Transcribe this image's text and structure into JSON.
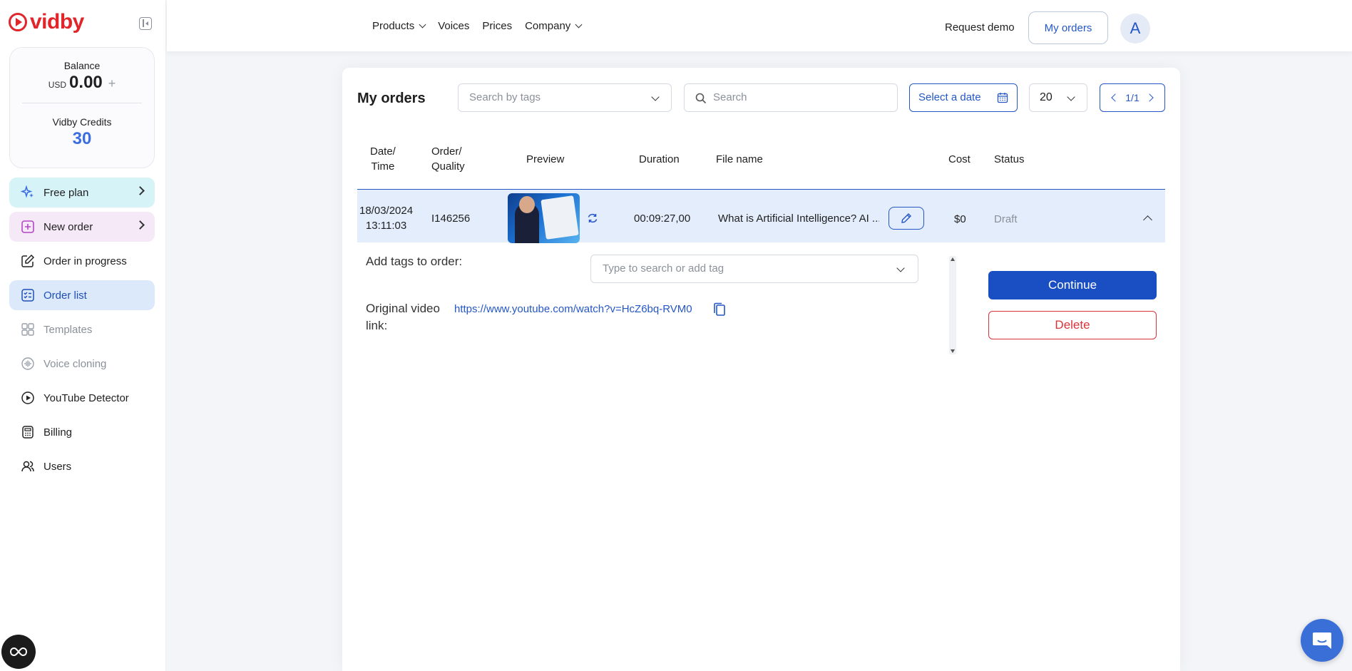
{
  "brand": {
    "name_prefix": "vid",
    "name_suffix": "by"
  },
  "balance": {
    "label": "Balance",
    "currency": "USD",
    "amount": "0.00",
    "plus": "+"
  },
  "credits": {
    "label": "Vidby Credits",
    "value": "30"
  },
  "sidebar": {
    "items": [
      {
        "label": "Free plan",
        "icon": "sparkle-icon"
      },
      {
        "label": "New order",
        "icon": "plus-square-icon"
      },
      {
        "label": "Order in progress",
        "icon": "edit-icon"
      },
      {
        "label": "Order list",
        "icon": "list-icon"
      },
      {
        "label": "Templates",
        "icon": "grid-icon"
      },
      {
        "label": "Voice cloning",
        "icon": "waveform-icon"
      },
      {
        "label": "YouTube Detector",
        "icon": "play-circle-icon"
      },
      {
        "label": "Billing",
        "icon": "calculator-icon"
      },
      {
        "label": "Users",
        "icon": "users-icon"
      }
    ]
  },
  "header": {
    "nav": [
      "Products",
      "Voices",
      "Prices",
      "Company"
    ],
    "request_demo": "Request demo",
    "my_orders": "My orders",
    "avatar": "A"
  },
  "orders": {
    "title": "My orders",
    "tags_placeholder": "Search by tags",
    "search_placeholder": "Search",
    "date_placeholder": "Select a date",
    "per_page": "20",
    "pager": "1/1",
    "columns": {
      "date_1": "Date/",
      "date_2": "Time",
      "order_1": "Order/",
      "order_2": "Quality",
      "preview": "Preview",
      "duration": "Duration",
      "file_name": "File name",
      "cost": "Cost",
      "status": "Status"
    },
    "rows": [
      {
        "date": "18/03/2024",
        "time": "13:11:03",
        "order_id": "I146256",
        "duration": "00:09:27,00",
        "file_name": "What is Artificial Intelligence? AI ...",
        "cost": "$0",
        "status": "Draft"
      }
    ],
    "detail": {
      "tags_label": "Add tags to order:",
      "tag_placeholder": "Type to search or add tag",
      "link_label_1": "Original video",
      "link_label_2": "link:",
      "link": "https://www.youtube.com/watch?v=HcZ6bq-RVM0",
      "continue": "Continue",
      "delete": "Delete"
    }
  },
  "colors": {
    "primary": "#1a4fc4",
    "danger": "#d9343a",
    "brand_red": "#e0262b",
    "row_highlight": "#e3edfb"
  }
}
